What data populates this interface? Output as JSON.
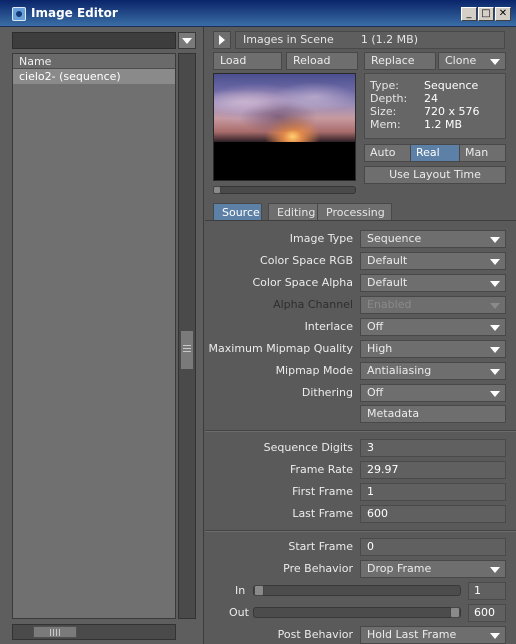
{
  "window": {
    "title": "Image Editor",
    "controls": {
      "minimize": "_",
      "maximize": "□",
      "close": "✕"
    }
  },
  "left": {
    "list_header": "Name",
    "items": [
      "cielo2- (sequence)"
    ]
  },
  "toolbar": {
    "images_label": "Images in Scene",
    "images_count": "1 (1.2 MB)",
    "load": "Load",
    "reload": "Reload",
    "replace": "Replace",
    "clone": "Clone"
  },
  "info": {
    "type_label": "Type:",
    "type_value": "Sequence",
    "depth_label": "Depth:",
    "depth_value": "24",
    "size_label": "Size:",
    "size_value": "720 x 576",
    "mem_label": "Mem:",
    "mem_value": "1.2 MB"
  },
  "modes": {
    "auto": "Auto",
    "real": "Real",
    "man": "Man",
    "active": "Real"
  },
  "use_layout_time": "Use Layout Time",
  "tabs": {
    "source": "Source",
    "editing": "Editing",
    "processing": "Processing",
    "active": "Source"
  },
  "source": {
    "image_type_label": "Image Type",
    "image_type_value": "Sequence",
    "cs_rgb_label": "Color Space RGB",
    "cs_rgb_value": "Default",
    "cs_alpha_label": "Color Space Alpha",
    "cs_alpha_value": "Default",
    "alpha_channel_label": "Alpha Channel",
    "alpha_channel_value": "Enabled",
    "interlace_label": "Interlace",
    "interlace_value": "Off",
    "mipmap_quality_label": "Maximum Mipmap Quality",
    "mipmap_quality_value": "High",
    "mipmap_mode_label": "Mipmap Mode",
    "mipmap_mode_value": "Antialiasing",
    "dithering_label": "Dithering",
    "dithering_value": "Off",
    "metadata_button": "Metadata",
    "seq_digits_label": "Sequence Digits",
    "seq_digits_value": "3",
    "frame_rate_label": "Frame Rate",
    "frame_rate_value": "29.97",
    "first_frame_label": "First Frame",
    "first_frame_value": "1",
    "last_frame_label": "Last Frame",
    "last_frame_value": "600",
    "start_frame_label": "Start Frame",
    "start_frame_value": "0",
    "pre_behavior_label": "Pre Behavior",
    "pre_behavior_value": "Drop Frame",
    "in_label": "In",
    "in_value": "1",
    "out_label": "Out",
    "out_value": "600",
    "post_behavior_label": "Post Behavior",
    "post_behavior_value": "Hold Last Frame"
  }
}
